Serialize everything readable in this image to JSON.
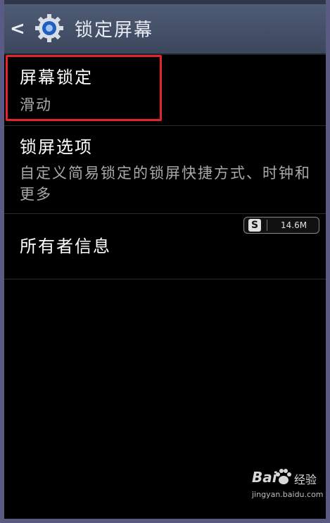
{
  "header": {
    "back_glyph": "<",
    "title": "锁定屏幕"
  },
  "settings": [
    {
      "title": "屏幕锁定",
      "subtitle": "滑动"
    },
    {
      "title": "锁屏选项",
      "subtitle": "自定义简易锁定的锁屏快捷方式、时钟和更多"
    },
    {
      "title": "所有者信息"
    }
  ],
  "memory_badge": {
    "icon_letter": "S",
    "value": "14.6M"
  },
  "watermark": {
    "logo": "Bai",
    "brand": "经验",
    "url": "jingyan.baidu.com"
  },
  "colors": {
    "header_bg": "#4a5670",
    "highlight_border": "#e3242b",
    "body_bg": "#000000",
    "frame": "#5b5a84"
  }
}
